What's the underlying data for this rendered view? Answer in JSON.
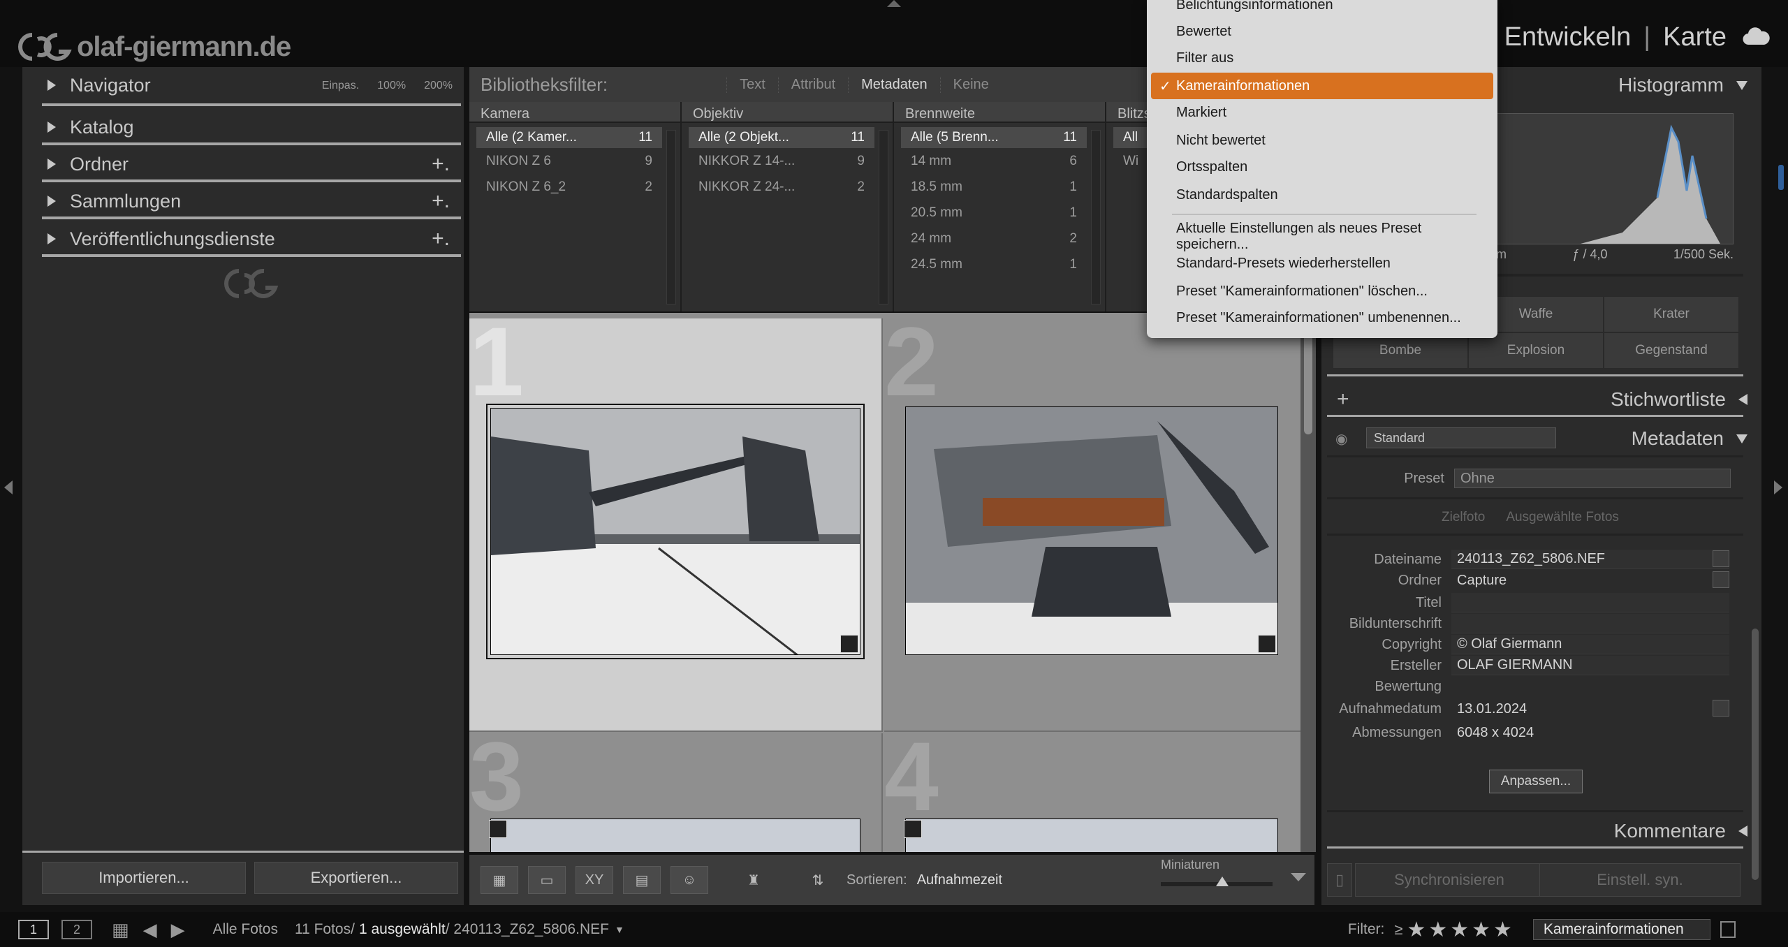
{
  "app": {
    "logo_text": "olaf-giermann.de",
    "modules": [
      "Entwickeln",
      "Karte"
    ],
    "module_sep": "|"
  },
  "left_panel": {
    "navigator": {
      "label": "Navigator",
      "options": [
        "Einpas.",
        "100%",
        "200%"
      ]
    },
    "sections": [
      {
        "label": "Katalog",
        "has_plus": false
      },
      {
        "label": "Ordner",
        "has_plus": true
      },
      {
        "label": "Sammlungen",
        "has_plus": true
      },
      {
        "label": "Veröffentlichungsdienste",
        "has_plus": true
      }
    ],
    "plus_symbol": "+.",
    "import_label": "Importieren...",
    "export_label": "Exportieren..."
  },
  "library_filter": {
    "title": "Bibliotheksfilter:",
    "tabs": [
      {
        "label": "Text",
        "active": false
      },
      {
        "label": "Attribut",
        "active": false
      },
      {
        "label": "Metadaten",
        "active": true
      },
      {
        "label": "Keine",
        "active": false
      }
    ],
    "columns": [
      {
        "header": "Kamera",
        "rows": [
          {
            "label": "Alle (2 Kamer...",
            "count": "11",
            "selected": true
          },
          {
            "label": "NIKON Z 6",
            "count": "9",
            "selected": false
          },
          {
            "label": "NIKON Z 6_2",
            "count": "2",
            "selected": false
          }
        ]
      },
      {
        "header": "Objektiv",
        "rows": [
          {
            "label": "Alle (2 Objekt...",
            "count": "11",
            "selected": true
          },
          {
            "label": "NIKKOR Z 14-...",
            "count": "9",
            "selected": false
          },
          {
            "label": "NIKKOR Z 24-...",
            "count": "2",
            "selected": false
          }
        ]
      },
      {
        "header": "Brennweite",
        "rows": [
          {
            "label": "Alle (5 Brenn...",
            "count": "11",
            "selected": true
          },
          {
            "label": "14 mm",
            "count": "6",
            "selected": false
          },
          {
            "label": "18.5 mm",
            "count": "1",
            "selected": false
          },
          {
            "label": "20.5 mm",
            "count": "1",
            "selected": false
          },
          {
            "label": "24 mm",
            "count": "2",
            "selected": false
          },
          {
            "label": "24.5 mm",
            "count": "1",
            "selected": false
          }
        ]
      },
      {
        "header": "Blitzs",
        "rows": [
          {
            "label": "All",
            "count": "",
            "selected": true
          },
          {
            "label": "Wi",
            "count": "",
            "selected": false
          }
        ]
      }
    ]
  },
  "grid": {
    "cells": [
      "1",
      "2",
      "3",
      "4"
    ]
  },
  "toolbar": {
    "sort_label": "Sortieren:",
    "sort_value": "Aufnahmezeit",
    "thumb_label": "Miniaturen",
    "thumb_level": 0.55
  },
  "right_panel": {
    "histogram": {
      "label": "Histogramm",
      "info_left": "m",
      "info_mid": "ƒ / 4,0",
      "info_right": "1/500 Sek."
    },
    "keywords": [
      "Waffe",
      "Krater",
      "Bombe",
      "Explosion",
      "Gegenstand"
    ],
    "keyword_list_label": "Stichwortliste",
    "keyword_plus": "+",
    "metadata": {
      "label": "Metadaten",
      "preset_select": "Standard",
      "preset_label": "Preset",
      "preset_value": "Ohne",
      "target_tab": "Zielfoto",
      "selected_tab": "Ausgewählte Fotos",
      "fields": [
        {
          "label": "Dateiname",
          "value": "240113_Z62_5806.NEF",
          "box": true,
          "btn": true
        },
        {
          "label": "Ordner",
          "value": "Capture",
          "box": false,
          "btn": true
        },
        {
          "label": "Titel",
          "value": "",
          "box": true,
          "btn": false
        },
        {
          "label": "Bildunterschrift",
          "value": "",
          "box": true,
          "btn": false
        },
        {
          "label": "Copyright",
          "value": "© Olaf Giermann",
          "box": true,
          "btn": false
        },
        {
          "label": "Ersteller",
          "value": "OLAF GIERMANN",
          "box": true,
          "btn": false
        },
        {
          "label": "Bewertung",
          "value": "",
          "box": false,
          "btn": false
        },
        {
          "label": "Aufnahmedatum",
          "value": "13.01.2024",
          "box": false,
          "btn": true
        },
        {
          "label": "Abmessungen",
          "value": "6048 x 4024",
          "box": false,
          "btn": false
        }
      ],
      "customize_label": "Anpassen..."
    },
    "comments_label": "Kommentare",
    "sync_label": "Synchronisieren",
    "sync_settings_label": "Einstell. syn."
  },
  "bottom_bar": {
    "screen1": "1",
    "screen2": "2",
    "source": "Alle Fotos",
    "count_text": "11 Fotos/",
    "selected_text": "1 ausgewählt",
    "file_text": "/ 240113_Z62_5806.NEF",
    "filter_label": "Filter:",
    "filter_op": "≥",
    "stars": "★★★★★",
    "filter_preset": "Kamerainformationen"
  },
  "dropdown": {
    "items": [
      {
        "label": "Belichtungsinformationen",
        "checked": false
      },
      {
        "label": "Bewertet",
        "checked": false
      },
      {
        "label": "Filter aus",
        "checked": false
      },
      {
        "label": "Kamerainformationen",
        "checked": true
      },
      {
        "label": "Markiert",
        "checked": false
      },
      {
        "label": "Nicht bewertet",
        "checked": false
      },
      {
        "label": "Ortsspalten",
        "checked": false
      },
      {
        "label": "Standardspalten",
        "checked": false
      }
    ],
    "actions": [
      "Aktuelle Einstellungen als neues Preset speichern...",
      "Standard-Presets wiederherstellen",
      "Preset \"Kamerainformationen\" löschen...",
      "Preset \"Kamerainformationen\" umbenennen..."
    ],
    "check_mark": "✓"
  },
  "colors": {
    "accent": "#d8711f",
    "panel_bg": "#2b2b2b",
    "grid_bg": "#8f8f8f"
  }
}
